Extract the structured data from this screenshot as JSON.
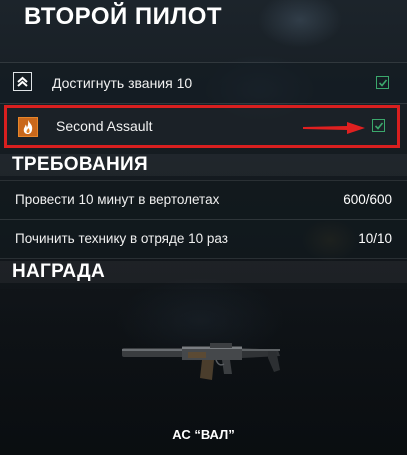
{
  "header": {
    "title": "ВТОРОЙ ПИЛОТ"
  },
  "objectives": [
    {
      "label": "Достигнуть звания 10",
      "icon": "rank-chevron-icon",
      "completed": true
    },
    {
      "label": "Second Assault",
      "icon": "flame-dlc-icon",
      "completed": true,
      "highlighted": true
    }
  ],
  "requirements": {
    "title": "ТРЕБОВАНИЯ",
    "items": [
      {
        "label": "Провести 10 минут в вертолетах",
        "value": "600/600"
      },
      {
        "label": "Починить технику в отряде 10 раз",
        "value": "10/10"
      }
    ]
  },
  "reward": {
    "title": "НАГРАДА",
    "name": "АС “ВАЛ”",
    "icon": "rifle-icon"
  },
  "colors": {
    "highlight_border": "#d91f1f",
    "check_green": "#3ba86c",
    "arrow_red": "#e02020",
    "dlc_icon_orange": "#e8862a"
  }
}
